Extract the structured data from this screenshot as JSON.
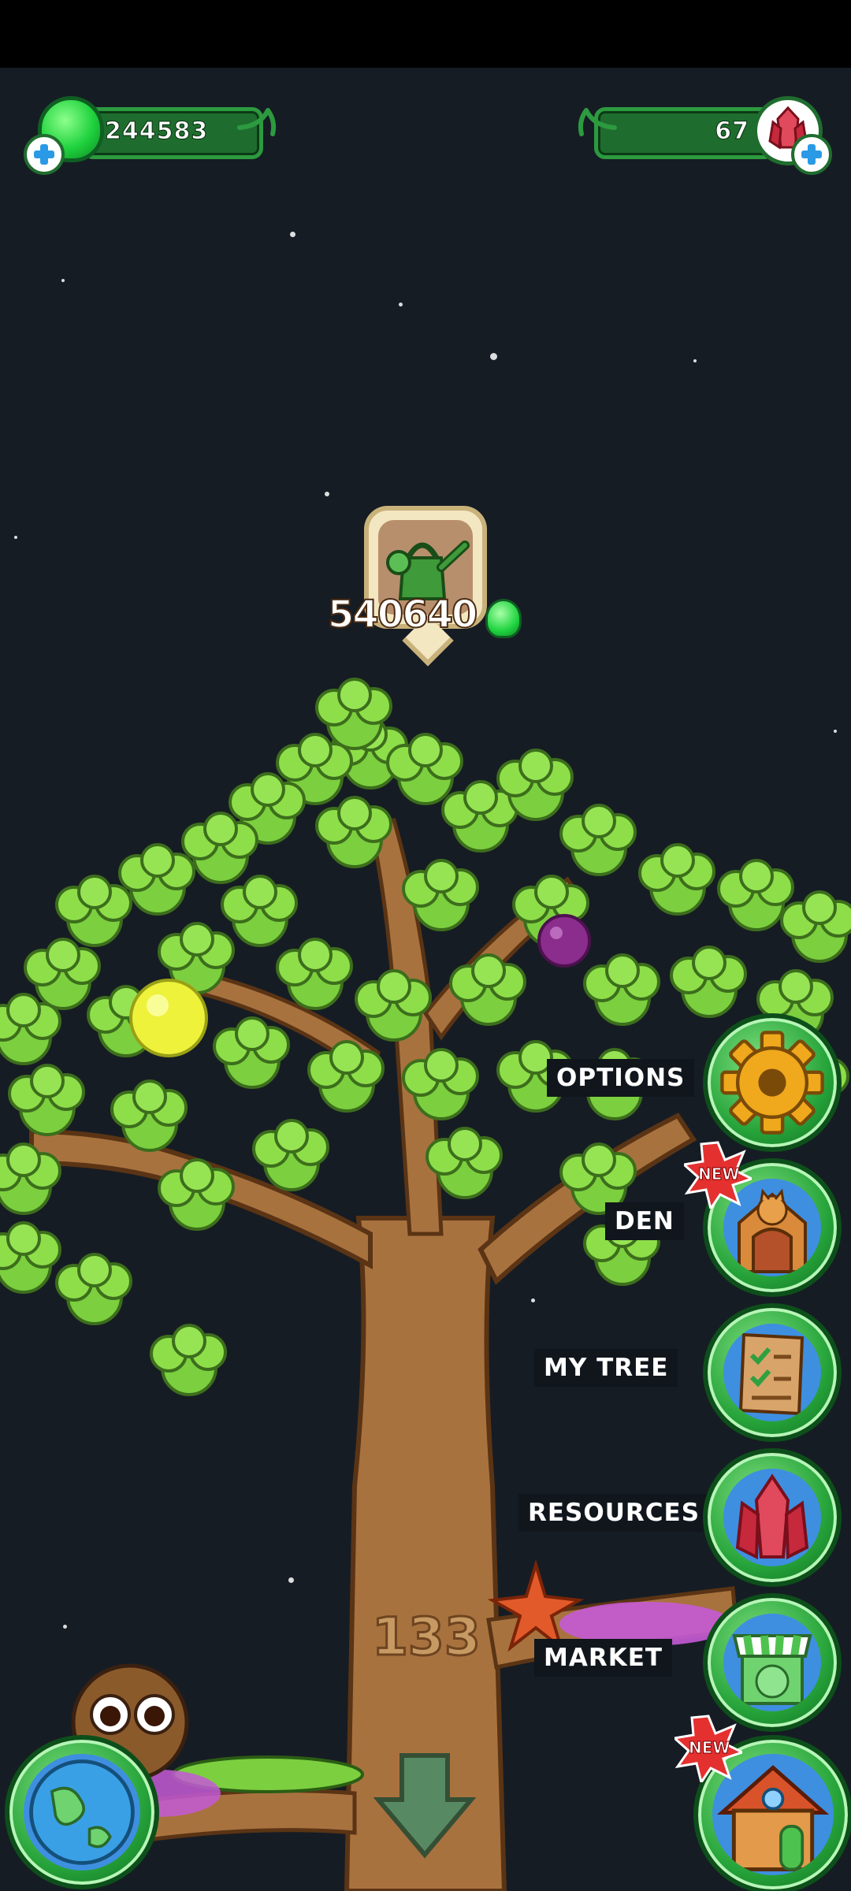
{
  "hud": {
    "green_currency": "244583",
    "gem_currency": "67"
  },
  "tree": {
    "water_cost": "540640",
    "level_number": "133"
  },
  "menu": {
    "options_label": "OPTIONS",
    "den_label": "DEN",
    "my_tree_label": "MY TREE",
    "resources_label": "RESOURCES",
    "market_label": "MARKET",
    "new_badge": "NEW",
    "new_badge_house": "NEW"
  },
  "icons": {
    "green_gem": "green-gem-icon",
    "red_gem": "red-gem-icon",
    "watering_can": "watering-can-icon",
    "gear": "gear-icon",
    "den": "den-house-icon",
    "checklist": "checklist-icon",
    "crystal": "crystal-icon",
    "market": "market-stall-icon",
    "globe": "globe-icon",
    "down_arrow": "down-arrow-icon",
    "home": "home-icon"
  },
  "colors": {
    "background": "#161c24",
    "leaf": "#7ccf3f",
    "trunk": "#a8723f",
    "button_green": "#26a33a",
    "badge_red": "#e53030"
  }
}
